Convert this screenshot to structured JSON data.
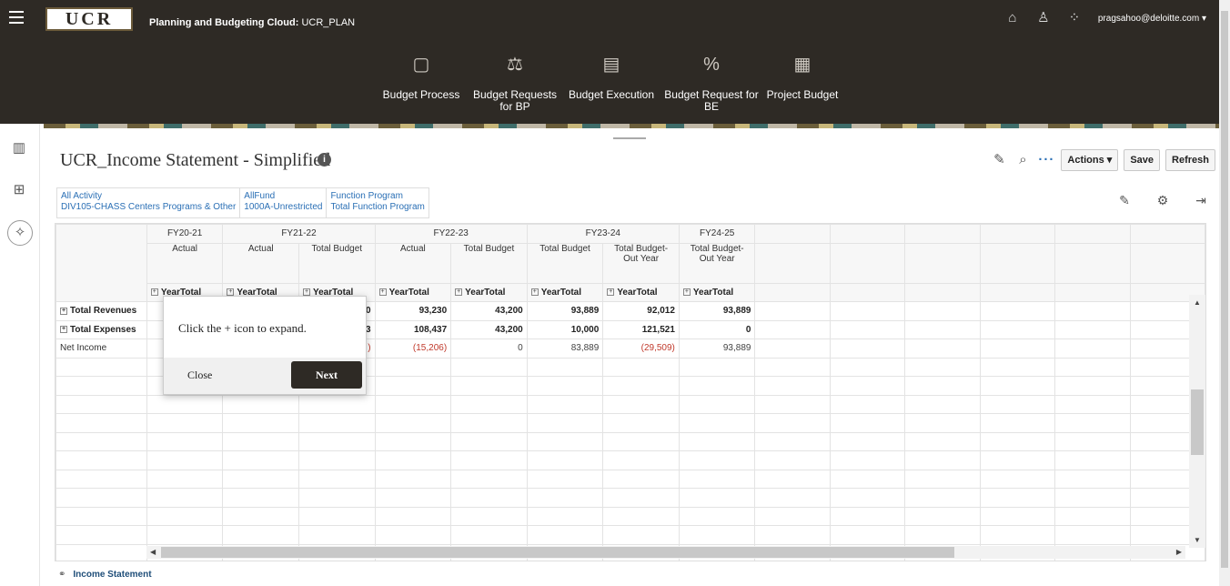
{
  "header": {
    "logo_text": "UCR",
    "app_prefix": "Planning and Budgeting Cloud:",
    "app_name": "UCR_PLAN",
    "user": "pragsahoo@deloitte.com ▾",
    "icons": [
      "home-icon",
      "accessibility-icon",
      "navigator-icon"
    ]
  },
  "nav": [
    {
      "label": "Budget Process",
      "icon": "folder-icon"
    },
    {
      "label": "Budget Requests for BP",
      "icon": "scale-icon"
    },
    {
      "label": "Budget Execution",
      "icon": "document-chart-icon"
    },
    {
      "label": "Budget Request for BE",
      "icon": "trend-percent-icon"
    },
    {
      "label": "Project Budget",
      "icon": "calendar-gear-icon"
    }
  ],
  "page": {
    "title": "UCR_Income Statement - Simplified",
    "actions_label": "Actions ▾",
    "save_label": "Save",
    "refresh_label": "Refresh"
  },
  "pov": [
    {
      "dim": "All Activity",
      "value": "DIV105-CHASS Centers Programs & Other"
    },
    {
      "dim": "AllFund",
      "value": "1000A-Unrestricted"
    },
    {
      "dim": "Function Program",
      "value": "Total Function Program"
    }
  ],
  "grid": {
    "years": [
      "FY20-21",
      "FY21-22",
      "FY22-23",
      "FY23-24",
      "FY24-25"
    ],
    "scenarios": [
      "Actual",
      "Actual",
      "Total Budget",
      "Actual",
      "Total Budget",
      "Total Budget",
      "Total Budget-Out Year",
      "Total Budget-Out Year"
    ],
    "period": "YearTotal",
    "rows": [
      {
        "label": "Total Revenues",
        "values": [
          "",
          "",
          "0",
          "93,230",
          "43,200",
          "93,889",
          "92,012",
          "93,889"
        ]
      },
      {
        "label": "Total Expenses",
        "values": [
          "",
          "",
          "3",
          "108,437",
          "43,200",
          "10,000",
          "121,521",
          "0"
        ]
      },
      {
        "label": "Net Income",
        "values": [
          "",
          "",
          ")",
          "(15,206)",
          "0",
          "83,889",
          "(29,509)",
          "93,889"
        ]
      }
    ]
  },
  "popup": {
    "message": "Click the + icon to expand.",
    "close_label": "Close",
    "next_label": "Next"
  },
  "bottom_tab": {
    "label": "Income Statement"
  }
}
